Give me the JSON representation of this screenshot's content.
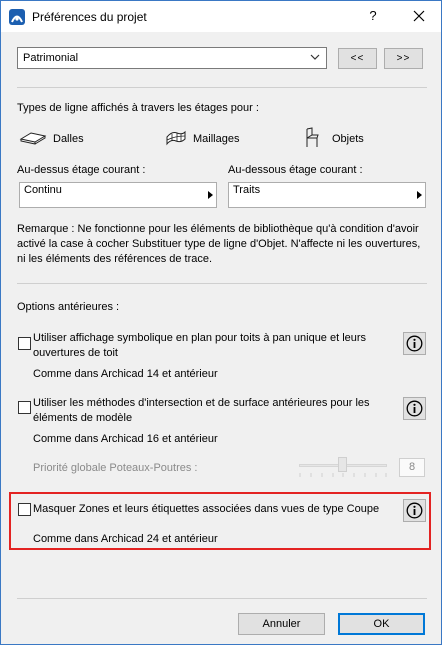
{
  "window": {
    "title": "Préférences du projet",
    "help_label": "?"
  },
  "preset": {
    "value": "Patrimonial",
    "prev_label": "<<",
    "next_label": ">>"
  },
  "line_types": {
    "heading": "Types de ligne affichés à travers les étages pour :",
    "slabs_label": "Dalles",
    "meshes_label": "Maillages",
    "objects_label": "Objets",
    "above_label": "Au-dessus étage courant :",
    "above_value": "Continu",
    "below_label": "Au-dessous étage courant :",
    "below_value": "Traits",
    "note": "Remarque : Ne fonctionne pour les éléments de bibliothèque qu'à condition d'avoir activé la case à cocher Substituer type de ligne d'Objet. N'affecte ni les ouvertures, ni les éléments des références de trace."
  },
  "legacy": {
    "heading": "Options antérieures :",
    "option1_label": "Utiliser affichage symbolique en plan pour toits à pan unique et leurs ouvertures de toit",
    "option1_checked": false,
    "option1_note": "Comme dans Archicad 14 et antérieur",
    "option2_label": "Utiliser les méthodes d'intersection et de surface antérieures pour les éléments de modèle",
    "option2_checked": false,
    "option2_note": "Comme dans Archicad 16 et antérieur",
    "priority_label": "Priorité globale Poteaux-Poutres :",
    "priority_value": "8",
    "option3_label": "Masquer Zones et leurs étiquettes associées dans vues de type Coupe",
    "option3_checked": false,
    "option3_note": "Comme dans Archicad 24 et antérieur"
  },
  "footer": {
    "cancel_label": "Annuler",
    "ok_label": "OK"
  }
}
